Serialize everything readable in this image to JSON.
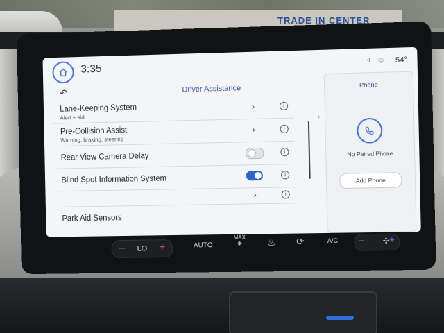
{
  "environment": {
    "sign_text": "TRADE IN CENTER"
  },
  "status_bar": {
    "time": "3:35",
    "temperature": "54°",
    "home_icon": "home-icon"
  },
  "driver_assistance": {
    "title": "Driver Assistance",
    "back_icon": "back-arrow-icon",
    "rows": [
      {
        "label": "Lane-Keeping System",
        "sub": "Alert + aid",
        "control": "chevron"
      },
      {
        "label": "Pre-Collision Assist",
        "sub": "Warning, braking, steering",
        "control": "chevron"
      },
      {
        "label": "Rear View Camera Delay",
        "sub": "",
        "control": "toggle",
        "state": "off"
      },
      {
        "label": "Blind Spot Information System",
        "sub": "",
        "control": "toggle",
        "state": "on"
      },
      {
        "label": "",
        "sub": "",
        "control": "chevron"
      },
      {
        "label": "Park Aid Sensors",
        "sub": "",
        "control": "none"
      }
    ]
  },
  "phone": {
    "title": "Phone",
    "status": "No Paired Phone",
    "add_button": "Add Phone",
    "icon": "phone-icon"
  },
  "climate": {
    "temp_setting": "LO",
    "auto": "AUTO",
    "max": "MAX",
    "ac": "A/C",
    "accent_minus": "#4c8af0",
    "accent_plus": "#e04848"
  },
  "colors": {
    "accent_blue": "#2e63c9",
    "title_blue": "#2a4f9c"
  }
}
